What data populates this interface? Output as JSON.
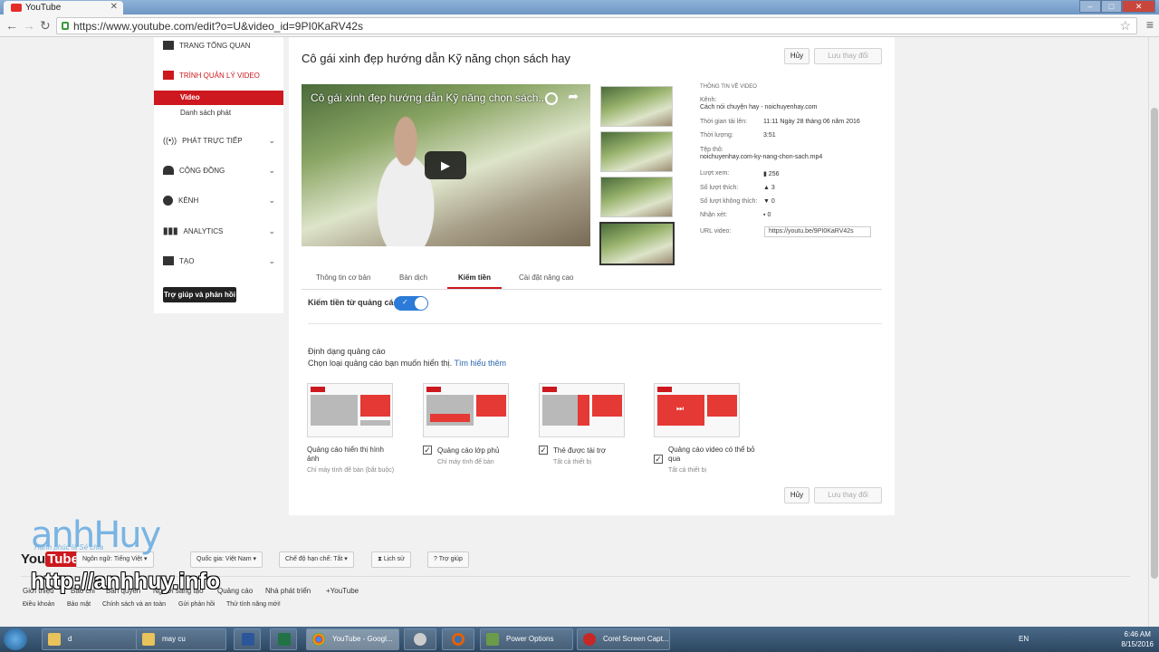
{
  "browser": {
    "tab_title": "YouTube",
    "url": "https://www.youtube.com/edit?o=U&video_id=9PI0KaRV42s"
  },
  "sidebar": {
    "items": [
      {
        "label": "TRANG TỔNG QUAN",
        "icon": "dashboard-icon"
      },
      {
        "label": "TRÌNH QUẢN LÝ VIDEO",
        "icon": "video-manager-icon"
      },
      {
        "label": "PHÁT TRỰC TIẾP",
        "icon": "live-icon"
      },
      {
        "label": "CỘNG ĐỒNG",
        "icon": "community-icon"
      },
      {
        "label": "KÊNH",
        "icon": "channel-icon"
      },
      {
        "label": "ANALYTICS",
        "icon": "analytics-icon"
      },
      {
        "label": "TẠO",
        "icon": "create-icon"
      }
    ],
    "sub_video": "Video",
    "sub_playlist": "Danh sách phát",
    "help_button": "Trợ giúp và phản hồi"
  },
  "editor": {
    "title": "Cô gái xinh đẹp hướng dẫn Kỹ năng chọn sách hay",
    "cancel": "Hủy",
    "save": "Lưu thay đổi",
    "player_title": "Cô gái xinh đẹp hướng dẫn Kỹ năng chọn sách...",
    "info": {
      "heading": "THÔNG TIN VỀ VIDEO",
      "channel_label": "Kênh:",
      "channel_value": "Cách nói chuyện hay - noichuyenhay.com",
      "uploaded_label": "Thời gian tải lên:",
      "uploaded_value": "11:11 Ngày 28 tháng 06 năm 2016",
      "duration_label": "Thời lượng:",
      "duration_value": "3:51",
      "file_label": "Tệp thô:",
      "file_value": "noichuyenhay.com-ky-nang-chon-sach.mp4",
      "views_label": "Lượt xem:",
      "views_value": "256",
      "likes_label": "Số lượt thích:",
      "likes_value": "3",
      "dislikes_label": "Số lượt không thích:",
      "dislikes_value": "0",
      "comments_label": "Nhận xét:",
      "comments_value": "0",
      "url_label": "URL video:",
      "url_value": "https://youtu.be/9PI0KaRV42s"
    },
    "tabs": [
      "Thông tin cơ bản",
      "Bản dịch",
      "Kiếm tiền",
      "Cài đặt nâng cao"
    ],
    "active_tab": "Kiếm tiền",
    "monetize_label": "Kiếm tiền từ quảng cáo",
    "monetize_on": true,
    "format_heading": "Định dạng quảng cáo",
    "format_choose": "Chọn loại quảng cáo bạn muốn hiển thị.",
    "learn_more": "Tìm hiểu thêm",
    "ad_formats": [
      {
        "label": "Quảng cáo hiển thị hình ảnh",
        "sub": "Chỉ máy tính để bàn (bắt buộc)",
        "checked": false
      },
      {
        "label": "Quảng cáo lớp phủ",
        "sub": "Chỉ máy tính để bàn",
        "checked": true
      },
      {
        "label": "Thẻ được tài trợ",
        "sub": "Tất cả thiết bị",
        "checked": true
      },
      {
        "label": "Quảng cáo video có thể bỏ qua",
        "sub": "Tất cả thiết bị",
        "checked": true
      }
    ]
  },
  "footer": {
    "logo_you": "You",
    "logo_tube": "Tube",
    "language": "Ngôn ngữ: Tiếng Việt",
    "country": "Quốc gia: Việt Nam",
    "restricted": "Chế độ hạn chế: Tắt",
    "history": "Lịch sử",
    "help": "Trợ giúp",
    "links1": [
      "Giới thiệu",
      "Báo chí",
      "Bản quyền",
      "Người sáng tạo",
      "Quảng cáo",
      "Nhà phát triển",
      "+YouTube"
    ],
    "links2": [
      "Điều khoản",
      "Bảo mật",
      "Chính sách và an toàn",
      "Gửi phản hồi",
      "Thử tính năng mới!"
    ]
  },
  "watermark": {
    "brand": "anhHuy",
    "slogan": "Hạnh phúc là Sẻ chia",
    "url": "http://anhhuy.info"
  },
  "taskbar": {
    "items": [
      "d",
      "may cu",
      "YouTube - Googl...",
      "Power Options",
      "Corel Screen Capt..."
    ],
    "lang": "EN",
    "time": "6:46 AM",
    "date": "8/15/2016"
  }
}
